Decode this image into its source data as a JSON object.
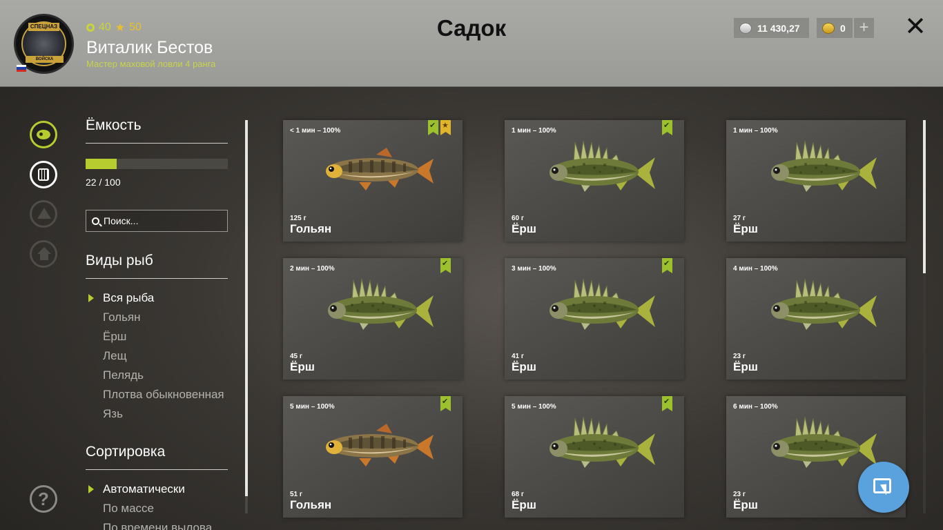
{
  "header": {
    "title": "Садок",
    "player": {
      "level": "40",
      "rank": "50",
      "name": "Виталик Бестов",
      "subtitle": "Мастер маховой ловли 4 ранга",
      "badge_top": "СПЕЦНАЗ",
      "badge_bottom": "ВОЙСКА",
      "flag_colors": [
        "#ffffff",
        "#1c3fa8",
        "#d52b1e"
      ]
    },
    "silver": "11 430,27",
    "gold": "0",
    "plus_label": "+",
    "close_label": "✕"
  },
  "sidebar_icons": [
    "fish-icon",
    "keepnet-icon",
    "tent-icon",
    "home-icon",
    "help-icon"
  ],
  "help_label": "?",
  "filters": {
    "capacity_title": "Ёмкость",
    "capacity_value": "22 / 100",
    "capacity_fraction": 0.22,
    "search_placeholder": "Поиск...",
    "species_title": "Виды рыб",
    "species": [
      "Вся рыба",
      "Гольян",
      "Ёрш",
      "Лещ",
      "Пелядь",
      "Плотва обыкновенная",
      "Язь"
    ],
    "species_active": 0,
    "sort_title": "Сортировка",
    "sort": [
      "Автоматически",
      "По массе",
      "По времени вылова"
    ],
    "sort_active": 0
  },
  "accent_color": "#b7cc2e",
  "fish": [
    {
      "time": "< 1 мин – 100%",
      "weight": "125 г",
      "name": "Гольян",
      "kind": "minnow",
      "check": true,
      "star": true
    },
    {
      "time": "1 мин – 100%",
      "weight": "60 г",
      "name": "Ёрш",
      "kind": "ruffe",
      "check": true,
      "star": false
    },
    {
      "time": "1 мин – 100%",
      "weight": "27 г",
      "name": "Ёрш",
      "kind": "ruffe",
      "check": false,
      "star": false
    },
    {
      "time": "2 мин – 100%",
      "weight": "45 г",
      "name": "Ёрш",
      "kind": "ruffe",
      "check": true,
      "star": false
    },
    {
      "time": "3 мин – 100%",
      "weight": "41 г",
      "name": "Ёрш",
      "kind": "ruffe",
      "check": true,
      "star": false
    },
    {
      "time": "4 мин – 100%",
      "weight": "23 г",
      "name": "Ёрш",
      "kind": "ruffe",
      "check": false,
      "star": false
    },
    {
      "time": "5 мин – 100%",
      "weight": "51 г",
      "name": "Гольян",
      "kind": "minnow",
      "check": true,
      "star": false
    },
    {
      "time": "5 мин – 100%",
      "weight": "68 г",
      "name": "Ёрш",
      "kind": "ruffe",
      "check": true,
      "star": false
    },
    {
      "time": "6 мин – 100%",
      "weight": "23 г",
      "name": "Ёрш",
      "kind": "ruffe",
      "check": false,
      "star": false
    }
  ]
}
